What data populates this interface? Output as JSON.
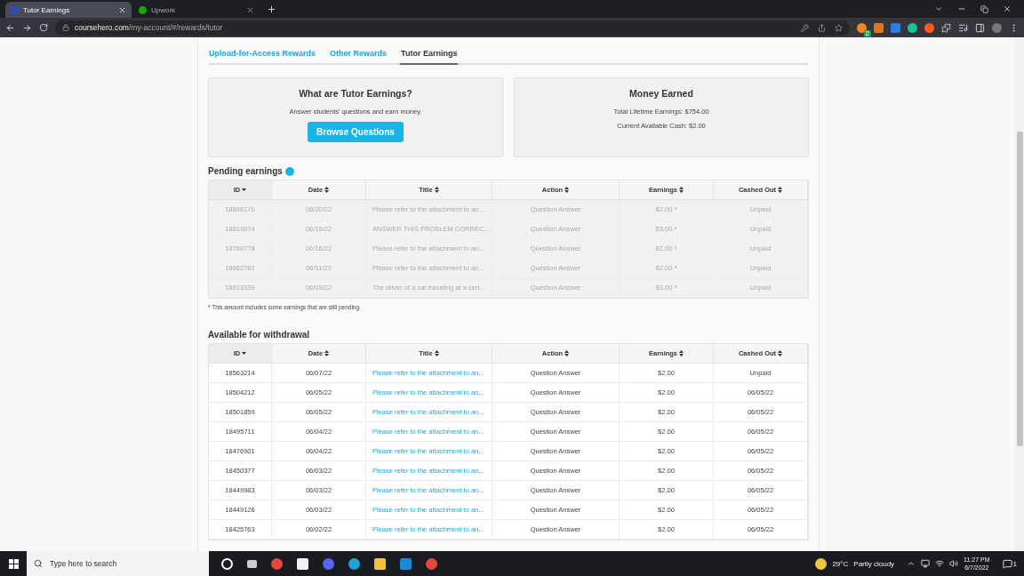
{
  "browser": {
    "tabs": [
      {
        "title": "Tutor Earnings",
        "selected": true
      },
      {
        "title": "Upwork",
        "selected": false
      }
    ],
    "url_host": "coursehero.com",
    "url_path": "/my-account/#/rewards/tutor",
    "extension_badge": "2"
  },
  "page": {
    "tabs": [
      {
        "label": "Upload-for-Access Rewards",
        "selected": false
      },
      {
        "label": "Other Rewards",
        "selected": false
      },
      {
        "label": "Tutor Earnings",
        "selected": true
      }
    ],
    "info_card": {
      "title": "What are Tutor Earnings?",
      "text": "Answer students' questions and earn money.",
      "button": "Browse Questions"
    },
    "money_card": {
      "title": "Money Earned",
      "lines": [
        "Total Lifetime Earnings: $754.00",
        "Current Available Cash: $2.00"
      ]
    },
    "sections": [
      {
        "heading": "Pending earnings",
        "info_dot": true,
        "pending": true,
        "columns": [
          {
            "label": "ID",
            "sorted": true
          },
          {
            "label": "Date",
            "sorted": false
          },
          {
            "label": "Title",
            "sorted": false
          },
          {
            "label": "Action",
            "sorted": false
          },
          {
            "label": "Earnings",
            "sorted": false
          },
          {
            "label": "Cashed Out",
            "sorted": false
          }
        ],
        "rows": [
          [
            "18848170",
            "06/20/22",
            "Please refer to the attachment to an...",
            "Question Answer",
            "$2.00 *",
            "Unpaid"
          ],
          [
            "18819074",
            "06/18/22",
            "ANSWER THIS PROBLEM CORREC...",
            "Question Answer",
            "$3.00 *",
            "Unpaid"
          ],
          [
            "18768778",
            "06/16/22",
            "Please refer to the attachment to an...",
            "Question Answer",
            "$2.00 *",
            "Unpaid"
          ],
          [
            "18662782",
            "06/11/22",
            "Please refer to the attachment to an...",
            "Question Answer",
            "$2.00 *",
            "Unpaid"
          ],
          [
            "18613339",
            "06/09/22",
            "The driver of a car traveling at a cert...",
            "Question Answer",
            "$3.00 *",
            "Unpaid"
          ]
        ],
        "footnote": "* This amount includes some earnings that are still pending."
      },
      {
        "heading": "Available for withdrawal",
        "info_dot": false,
        "pending": false,
        "columns": [
          {
            "label": "ID",
            "sorted": true
          },
          {
            "label": "Date",
            "sorted": false
          },
          {
            "label": "Title",
            "sorted": false
          },
          {
            "label": "Action",
            "sorted": false
          },
          {
            "label": "Earnings",
            "sorted": false
          },
          {
            "label": "Cashed Out",
            "sorted": false
          }
        ],
        "rows": [
          [
            "18563214",
            "06/07/22",
            "Please refer to the attachment to an...",
            "Question Answer",
            "$2.00",
            "Unpaid"
          ],
          [
            "18504212",
            "06/05/22",
            "Please refer to the attachment to an...",
            "Question Answer",
            "$2.00",
            "06/05/22"
          ],
          [
            "18501859",
            "06/05/22",
            "Please refer to the attachment to an...",
            "Question Answer",
            "$2.00",
            "06/05/22"
          ],
          [
            "18495711",
            "06/04/22",
            "Please refer to the attachment to an...",
            "Question Answer",
            "$2.00",
            "06/05/22"
          ],
          [
            "18476901",
            "06/04/22",
            "Please refer to the attachment to an...",
            "Question Answer",
            "$2.00",
            "06/05/22"
          ],
          [
            "18450377",
            "06/03/22",
            "Please refer to the attachment to an...",
            "Question Answer",
            "$2.00",
            "06/05/22"
          ],
          [
            "18449983",
            "06/03/22",
            "Please refer to the attachment to an...",
            "Question Answer",
            "$2.00",
            "06/05/22"
          ],
          [
            "18449126",
            "06/03/22",
            "Please refer to the attachment to an...",
            "Question Answer",
            "$2.00",
            "06/05/22"
          ],
          [
            "18425763",
            "06/02/22",
            "Please refer to the attachment to an...",
            "Question Answer",
            "$2.00",
            "06/05/22"
          ]
        ]
      }
    ]
  },
  "taskbar": {
    "search_placeholder": "Type here to search",
    "temperature": "29°C",
    "weather": "Partly cloudy",
    "time": "11:27 PM",
    "date": "6/7/2022",
    "notification_count": "1"
  }
}
